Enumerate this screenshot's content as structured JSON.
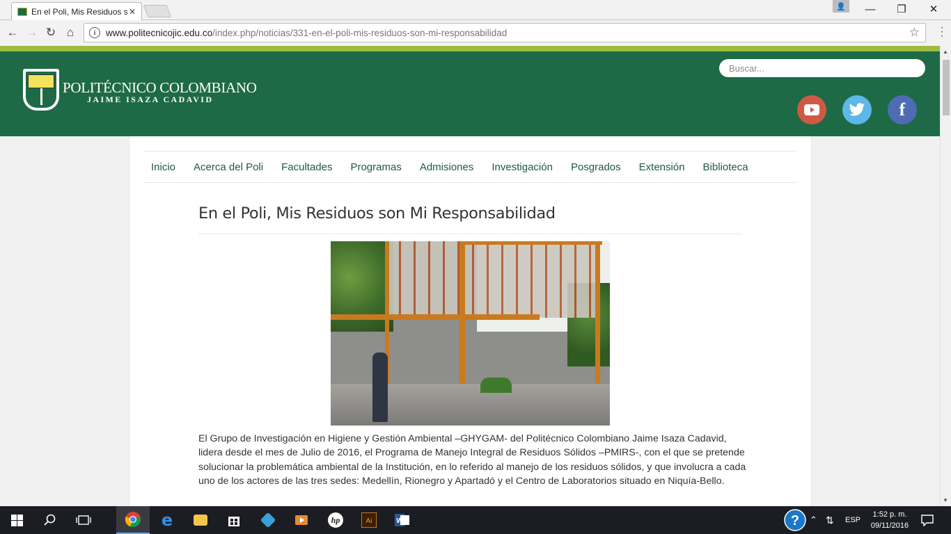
{
  "browser": {
    "tab_title": "En el Poli, Mis Residuos s",
    "url_host": "www.politecnicojic.edu.co",
    "url_path": "/index.php/noticias/331-en-el-poli-mis-residuos-son-mi-responsabilidad"
  },
  "header": {
    "logo_line1": "POLITÉCNICO COLOMBIANO",
    "logo_line2": "JAIME ISAZA CADAVID",
    "search_placeholder": "Buscar...",
    "colors": {
      "header_bg": "#1e6a46",
      "accent_stripe": "#9cbc3d",
      "youtube": "#cf5a43",
      "twitter": "#5eb7e9",
      "facebook": "#4d6cb4"
    }
  },
  "nav": {
    "items": [
      "Inicio",
      "Acerca del Poli",
      "Facultades",
      "Programas",
      "Admisiones",
      "Investigación",
      "Posgrados",
      "Extensión",
      "Biblioteca"
    ]
  },
  "article": {
    "title": "En el Poli, Mis Residuos son Mi Responsabilidad",
    "body": "El Grupo de Investigación en Higiene y Gestión Ambiental –GHYGAM- del Politécnico Colombiano Jaime Isaza Cadavid, lidera desde el mes de Julio de 2016, el Programa de Manejo Integral de Residuos Sólidos –PMIRS-, con el que se pretende solucionar la problemática ambiental de la Institución, en lo referido al manejo de los residuos sólidos, y que involucra a cada uno de los actores de las tres sedes: Medellín, Rionegro y Apartadó y el Centro de Laboratorios situado en Niquía-Bello."
  },
  "taskbar": {
    "language": "ESP",
    "time": "1:52 p. m.",
    "date": "09/11/2016"
  }
}
